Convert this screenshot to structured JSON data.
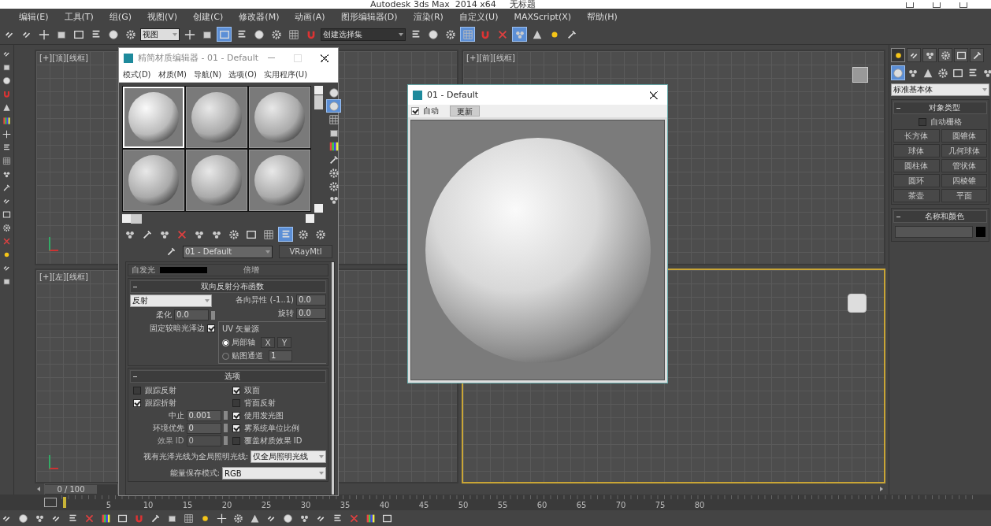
{
  "window": {
    "title": "Autodesk 3ds Max  2014 x64     无标题"
  },
  "menu": [
    "编辑(E)",
    "工具(T)",
    "组(G)",
    "视图(V)",
    "创建(C)",
    "修改器(M)",
    "动画(A)",
    "图形编辑器(D)",
    "渲染(R)",
    "自定义(U)",
    "MAXScript(X)",
    "帮助(H)"
  ],
  "toolbar": {
    "left": [
      {
        "active": false
      },
      {
        "active": false
      },
      {
        "active": false
      },
      {
        "active": false
      },
      {
        "active": false
      },
      {
        "active": false
      },
      {
        "active": false
      },
      {
        "active": false
      }
    ],
    "view_dropdown": "视图",
    "mid": [
      {
        "active": false
      },
      {
        "active": false
      },
      {
        "active": true
      },
      {
        "active": false
      },
      {
        "active": false
      },
      {
        "active": false
      },
      {
        "active": false
      },
      {
        "active": false
      }
    ],
    "selection_set": "创建选择集",
    "right": [
      {
        "active": false
      },
      {
        "active": false
      },
      {
        "active": false
      },
      {
        "active": true
      },
      {
        "active": false
      },
      {
        "active": false
      },
      {
        "active": true
      },
      {
        "active": false
      },
      {
        "active": false
      },
      {
        "active": false
      }
    ]
  },
  "viewports": [
    {
      "label": "[+][顶][线框]",
      "active": false
    },
    {
      "label": "[+][前][线框]",
      "active": false
    },
    {
      "label": "[+][左][线框]",
      "active": false
    },
    {
      "active": true
    }
  ],
  "time_slider": {
    "text": "0 / 100",
    "level": 0
  },
  "timeline": {
    "ticks": [
      "5",
      "10",
      "15",
      "20",
      "25",
      "30",
      "35",
      "40",
      "45",
      "50",
      "55",
      "60",
      "65",
      "70",
      "75",
      "80"
    ]
  },
  "material_editor": {
    "title": "精简材质编辑器 - 01 - Default",
    "menu": [
      "模式(D)",
      "材质(M)",
      "导航(N)",
      "选项(O)",
      "实用程序(U)"
    ],
    "slots": [
      {
        "selected": true
      },
      {
        "selected": false
      },
      {
        "selected": false
      },
      {
        "selected": false
      },
      {
        "selected": false
      },
      {
        "selected": false
      }
    ],
    "side_tools": [
      {
        "active": false
      },
      {
        "active": true
      },
      {
        "active": false
      },
      {
        "active": false
      },
      {
        "active": false
      },
      {
        "active": false
      },
      {
        "active": false
      },
      {
        "active": false
      },
      {
        "active": false
      }
    ],
    "tools": [
      {
        "active": false
      },
      {
        "active": false
      },
      {
        "active": false
      },
      {
        "active": false
      },
      {
        "active": false
      },
      {
        "active": false
      },
      {
        "active": false
      },
      {
        "active": false
      },
      {
        "active": false
      },
      {
        "active": true
      },
      {
        "active": false
      },
      {
        "active": false
      }
    ],
    "material_name": "01 - Default",
    "material_type": "VRayMtl",
    "partial_row": {
      "label": "自发光",
      "multiplier_label": "倍增"
    },
    "brdf": {
      "title": "双向反射分布函数",
      "type": "反射",
      "anisotropy_label": "各向异性 (-1..1)",
      "anisotropy": "0.0",
      "rotation_label": "旋转",
      "rotation": "0.0",
      "soften_label": "柔化",
      "soften": "0.0",
      "fix_label": "固定较暗光泽边",
      "fix_checked": true,
      "uv_title": "UV 矢量源",
      "uv_options": [
        {
          "label": "局部轴",
          "selected": true
        },
        {
          "label": "贴图通道",
          "selected": false
        }
      ],
      "axis_buttons": [
        "X",
        "Y"
      ],
      "channel": "1"
    },
    "options": {
      "title": "选项",
      "checks_left": [
        {
          "label": "跟踪反射",
          "checked": false
        },
        {
          "label": "跟踪折射",
          "checked": true
        }
      ],
      "checks_right": [
        {
          "label": "双面",
          "checked": true
        },
        {
          "label": "背面反射",
          "checked": false
        },
        {
          "label": "使用发光图",
          "checked": true
        },
        {
          "label": "雾系统单位比例",
          "checked": true
        },
        {
          "label": "覆盖材质效果 ID",
          "checked": false
        }
      ],
      "fields": [
        {
          "label": "中止",
          "value": "0.001",
          "disabled": false
        },
        {
          "label": "环境优先",
          "value": "0",
          "disabled": false
        },
        {
          "label": "效果 ID",
          "value": "0",
          "disabled": true
        }
      ],
      "glossy_label": "视有光泽光线为全局照明光线:",
      "glossy_value": "仅全局照明光线",
      "energy_label": "能量保存模式:",
      "energy_value": "RGB"
    }
  },
  "render_window": {
    "title": "01 - Default",
    "auto_label": "自动",
    "auto_checked": true,
    "update_button": "更新"
  },
  "command_panel": {
    "tabs": [
      {
        "selected": true
      },
      {
        "selected": false
      },
      {
        "selected": false
      },
      {
        "selected": false
      },
      {
        "selected": false
      },
      {
        "selected": false
      }
    ],
    "categories": [
      {
        "selected": true
      },
      {
        "selected": false
      },
      {
        "selected": false
      },
      {
        "selected": false
      },
      {
        "selected": false
      },
      {
        "selected": false
      },
      {
        "selected": false
      }
    ],
    "dropdown": "标准基本体",
    "object_type": {
      "title": "对象类型",
      "autogrid_label": "自动栅格",
      "autogrid": false,
      "buttons": [
        "长方体",
        "圆锥体",
        "球体",
        "几何球体",
        "圆柱体",
        "管状体",
        "圆环",
        "四棱锥",
        "茶壶",
        "平面"
      ]
    },
    "name_color": {
      "title": "名称和颜色",
      "color": "#000000"
    }
  }
}
